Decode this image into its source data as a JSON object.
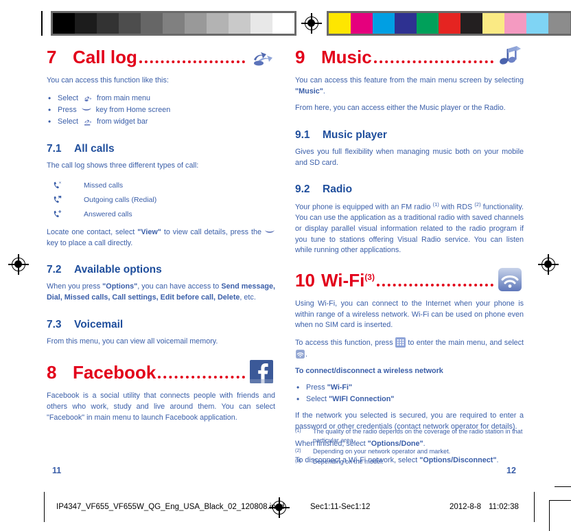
{
  "calibration": {
    "grayscale": [
      "#000000",
      "#1c1c1c",
      "#333333",
      "#4d4d4d",
      "#666666",
      "#808080",
      "#999999",
      "#b3b3b3",
      "#c9c9c9",
      "#e8e8e8",
      "#ffffff"
    ],
    "colors": [
      "#fee600",
      "#e5007d",
      "#009fe3",
      "#2e3191",
      "#00a05a",
      "#e52421",
      "#231f20",
      "#faea84",
      "#f49ac1",
      "#7fd4f4",
      "#8c8c8c"
    ],
    "registration_icon": "registration-target-icon"
  },
  "left_column": {
    "section7": {
      "number": "7",
      "title": "Call log",
      "icon": "call-log-icon",
      "intro": "You can access this function like this:",
      "bullets": [
        {
          "pre": "Select",
          "icon": "call-log-small-icon",
          "post": "from main menu"
        },
        {
          "pre": "Press",
          "icon": "call-key-icon",
          "post": "key from Home screen"
        },
        {
          "pre": "Select",
          "icon": "widget-bar-icon",
          "post": "from widget bar"
        }
      ]
    },
    "section7_1": {
      "number": "7.1",
      "title": "All calls",
      "intro": "The call log shows three different types of call:",
      "call_types": [
        {
          "icon": "missed-call-icon",
          "label": "Missed calls"
        },
        {
          "icon": "outgoing-call-icon",
          "label": "Outgoing calls (Redial)"
        },
        {
          "icon": "answered-call-icon",
          "label": "Answered calls"
        }
      ],
      "note_pre": "Locate one contact, select ",
      "note_bold": "\"View\"",
      "note_mid": " to view call details, press the ",
      "note_icon": "call-key-icon",
      "note_post": " key to place a call directly."
    },
    "section7_2": {
      "number": "7.2",
      "title": "Available options",
      "text_pre": "When you press ",
      "text_bold1": "\"Options\"",
      "text_mid": ", you can have access to ",
      "text_bold2": "Send message, Dial, Missed calls, Call settings, Edit before call, Delete",
      "text_post": ", etc."
    },
    "section7_3": {
      "number": "7.3",
      "title": "Voicemail",
      "text": "From this menu, you can view all voicemail memory."
    },
    "section8": {
      "number": "8",
      "title": "Facebook",
      "icon": "facebook-icon",
      "icon_letter": "f",
      "text": "Facebook is a social utility that connects people with friends and others who work, study and live around them. You can select \"Facebook\" in main menu to launch Facebook application."
    },
    "page_number": "11"
  },
  "right_column": {
    "section9": {
      "number": "9",
      "title": "Music",
      "icon": "music-note-icon",
      "para1_pre": "You can access this feature from the main menu screen by selecting ",
      "para1_bold": "\"Music\"",
      "para1_post": ".",
      "para2": "From here, you can access either the Music player or the Radio."
    },
    "section9_1": {
      "number": "9.1",
      "title": "Music player",
      "text": "Gives you full flexibility when managing music both on your mobile and SD card."
    },
    "section9_2": {
      "number": "9.2",
      "title": "Radio",
      "text_a": "Your phone is equipped with an FM radio ",
      "sup1": "(1)",
      "text_b": " with RDS ",
      "sup2": "(2)",
      "text_c": " functionality. You can use the application as a traditional radio with saved channels or display parallel visual information related to the radio program if you tune to stations offering Visual Radio service. You can listen while running other applications."
    },
    "section10": {
      "number": "10",
      "title": "Wi-Fi",
      "sup": "(3)",
      "icon": "wifi-icon",
      "para1": "Using Wi-Fi, you can connect to the Internet when your phone is within range of a wireless network. Wi-Fi can be used on phone even when no SIM card is inserted.",
      "para2_pre": "To access this function, press ",
      "para2_icon": "main-menu-grid-icon",
      "para2_mid": " to enter the main menu, and select ",
      "para2_icon2": "wifi-small-icon",
      "para2_post": ".",
      "subheading": "To connect/disconnect a wireless network",
      "bullets": [
        {
          "pre": "Press ",
          "bold": "\"Wi-Fi\""
        },
        {
          "pre": "Select ",
          "bold": "\"WIFI Connection\""
        }
      ],
      "para3": "If the network you selected is secured, you are required to enter a password or other credentials (contact network operator for details).",
      "para4_pre": "When finished, select ",
      "para4_bold": "\"Options/Done\"",
      "para4_post": ".",
      "para5_pre": "To disconnect a Wi-Fi network, select ",
      "para5_bold": "\"Options/Disconnect\"",
      "para5_post": "."
    },
    "footnotes": [
      {
        "marker": "(1)",
        "text": "The quality of the radio depends on the coverage of the radio station in that particular area."
      },
      {
        "marker": "(2)",
        "text": "Depending on your network operator and market."
      },
      {
        "marker": "(3)",
        "text": "Depending on the model."
      }
    ],
    "page_number": "12"
  },
  "footer": {
    "filename": "IP4347_VF655_VF655W_QG_Eng_USA_Black_02_120808.indd",
    "section_range": "Sec1:11-Sec1:12",
    "date": "2012-8-8",
    "time": "11:02:38"
  },
  "theme": {
    "heading_red": "#e2001a",
    "heading_blue": "#1f4e9c",
    "body_blue": "#3a5ea8",
    "facebook_blue": "#3b5998"
  }
}
